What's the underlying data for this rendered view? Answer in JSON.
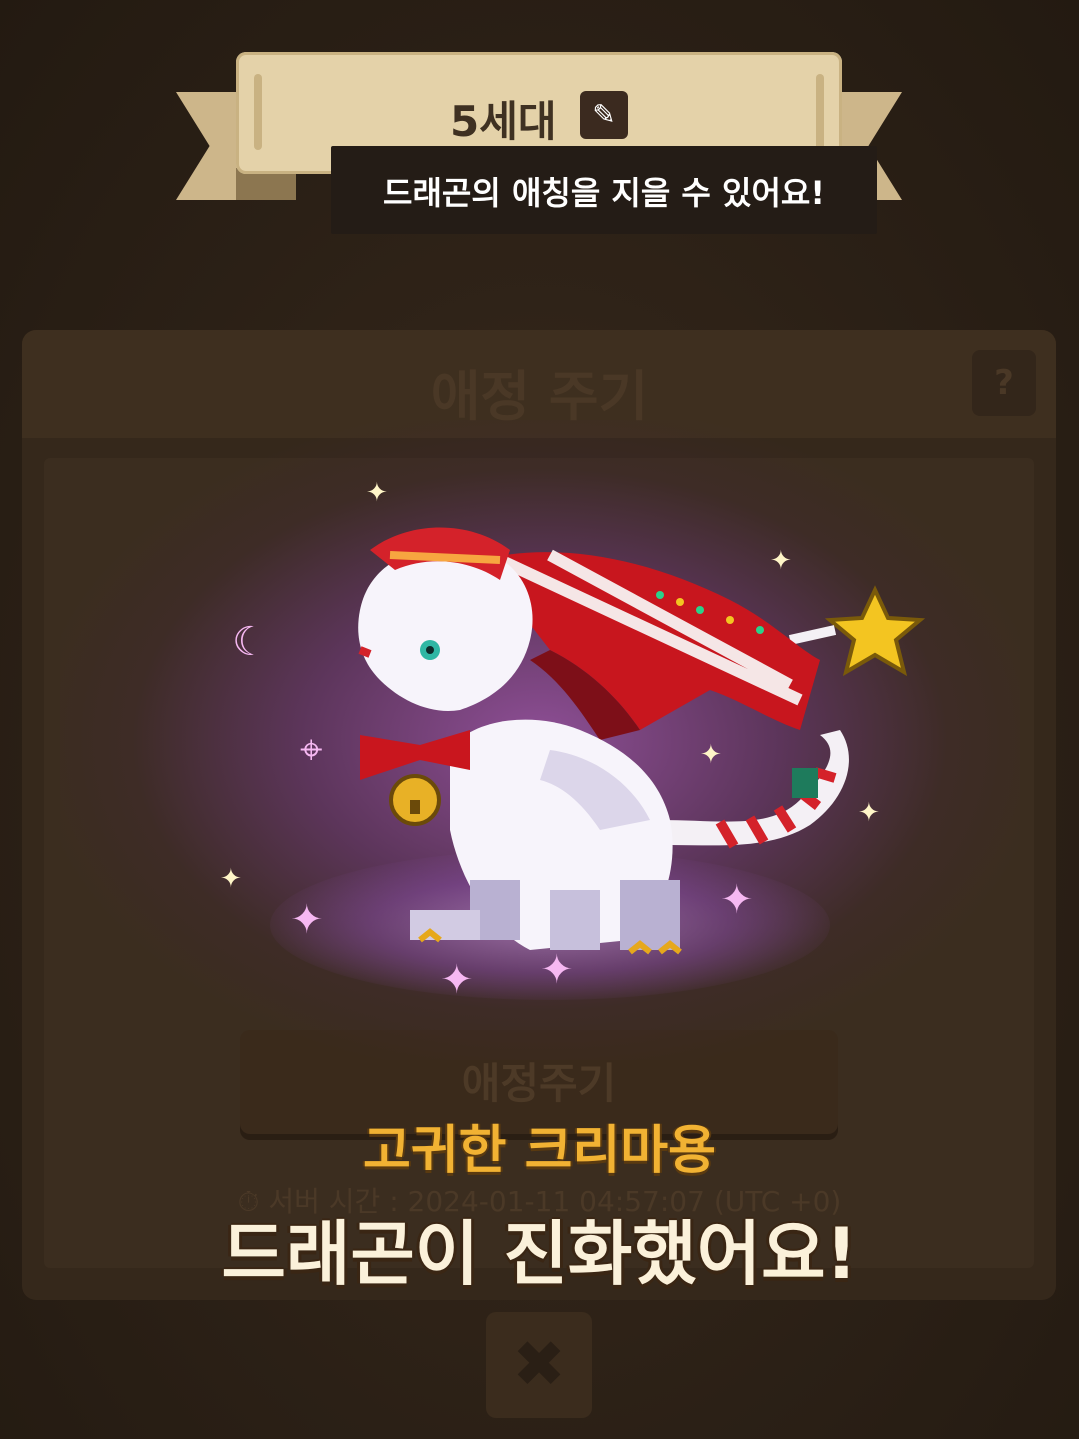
{
  "header": {
    "generation_label": "5세대",
    "edit_icon": "pencil-icon",
    "tooltip": "드래곤의 애칭을 지을 수 있어요!"
  },
  "background_panel": {
    "title": "애정 주기",
    "help_label": "?",
    "button_label": "애정주기",
    "server_time": "⏱ 서버 시간 : 2024-01-11 04:57:07 (UTC +0)",
    "close_label": "✖"
  },
  "result": {
    "dragon_name": "고귀한 크리마용",
    "message": "드래곤이 진화했어요!"
  },
  "colors": {
    "accent_gold": "#f1b233",
    "ribbon": "#e4d2a9",
    "glow": "#a85ac0"
  }
}
